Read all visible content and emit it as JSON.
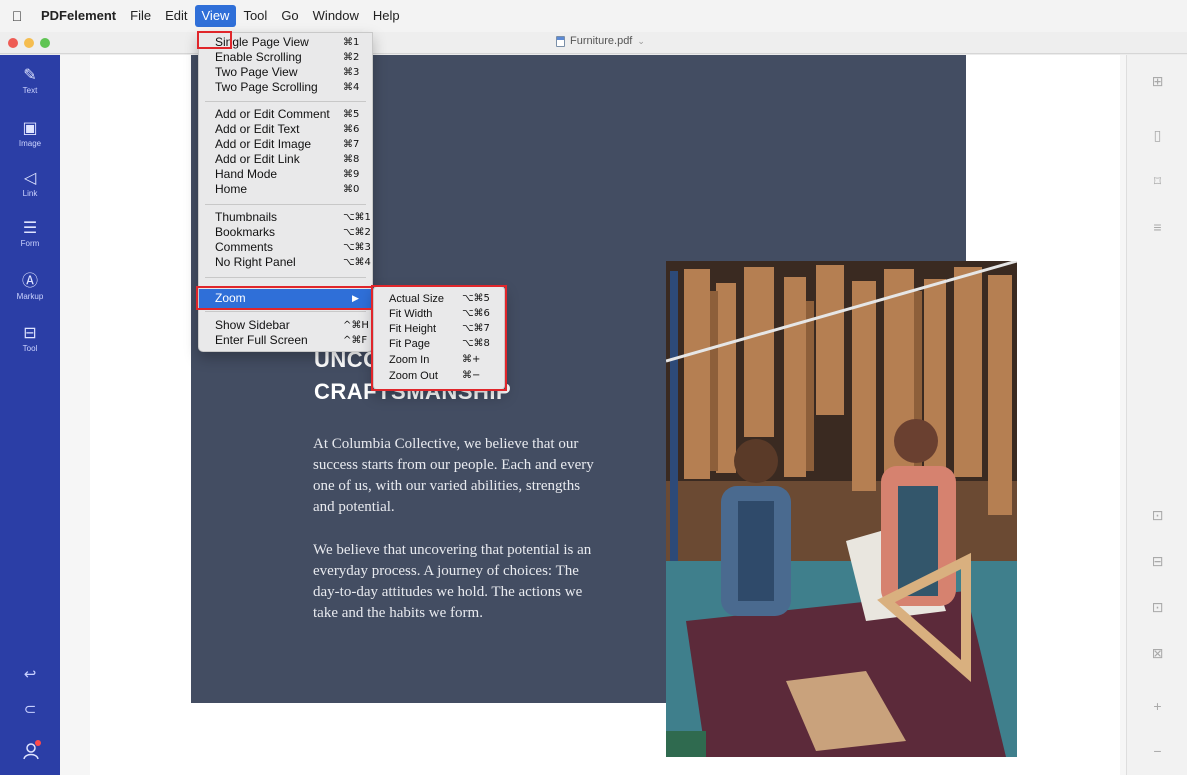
{
  "menubar": {
    "app": "PDFelement",
    "items": [
      "File",
      "Edit",
      "View",
      "Tool",
      "Go",
      "Window",
      "Help"
    ]
  },
  "window": {
    "doc_title": "Furniture.pdf"
  },
  "left_tools": [
    "Text",
    "Image",
    "Link",
    "Form",
    "Markup",
    "Tool"
  ],
  "view_menu": {
    "group1": [
      {
        "label": "Single Page View",
        "shortcut": "⌘1"
      },
      {
        "label": "Enable Scrolling",
        "shortcut": "⌘2"
      },
      {
        "label": "Two Page View",
        "shortcut": "⌘3"
      },
      {
        "label": "Two Page Scrolling",
        "shortcut": "⌘4"
      }
    ],
    "group2": [
      {
        "label": "Add or Edit Comment",
        "shortcut": "⌘5"
      },
      {
        "label": "Add or Edit Text",
        "shortcut": "⌘6"
      },
      {
        "label": "Add or Edit Image",
        "shortcut": "⌘7"
      },
      {
        "label": "Add or Edit Link",
        "shortcut": "⌘8"
      },
      {
        "label": "Hand Mode",
        "shortcut": "⌘9"
      },
      {
        "label": "Home",
        "shortcut": "⌘0"
      }
    ],
    "group3": [
      {
        "label": "Thumbnails",
        "shortcut": "⌥⌘1"
      },
      {
        "label": "Bookmarks",
        "shortcut": "⌥⌘2"
      },
      {
        "label": "Comments",
        "shortcut": "⌥⌘3"
      },
      {
        "label": "No Right Panel",
        "shortcut": "⌥⌘4"
      }
    ],
    "zoom": {
      "label": "Zoom",
      "arrow": "▶"
    },
    "group4": [
      {
        "label": "Show Sidebar",
        "shortcut": "^⌘H"
      },
      {
        "label": "Enter Full Screen",
        "shortcut": "^⌘F"
      }
    ]
  },
  "zoom_submenu": [
    {
      "label": "Actual Size",
      "shortcut": "⌥⌘5"
    },
    {
      "label": "Fit Width",
      "shortcut": "⌥⌘6"
    },
    {
      "label": "Fit Height",
      "shortcut": "⌥⌘7"
    },
    {
      "label": "Fit Page",
      "shortcut": "⌥⌘8"
    },
    {
      "label": "Zoom In",
      "shortcut": "⌘+"
    },
    {
      "label": "Zoom Out",
      "shortcut": "⌘−"
    }
  ],
  "document": {
    "heading_line1": "UNCO          ING",
    "heading_line2": "CRAFTSMANSHIP",
    "para1": "At Columbia Collective, we believe that our success starts from our people. Each and every one of us, with our varied abilities, strengths and potential.",
    "para2": "We believe that uncovering that potential is an everyday process. A journey of choices: The day-to-day attitudes we hold. The actions we take and the habits we form."
  },
  "colors": {
    "sidebar": "#2b3ea6",
    "page_panel": "#434d62",
    "menu_highlight": "#2f6fd8",
    "annotation": "#e0262b"
  }
}
